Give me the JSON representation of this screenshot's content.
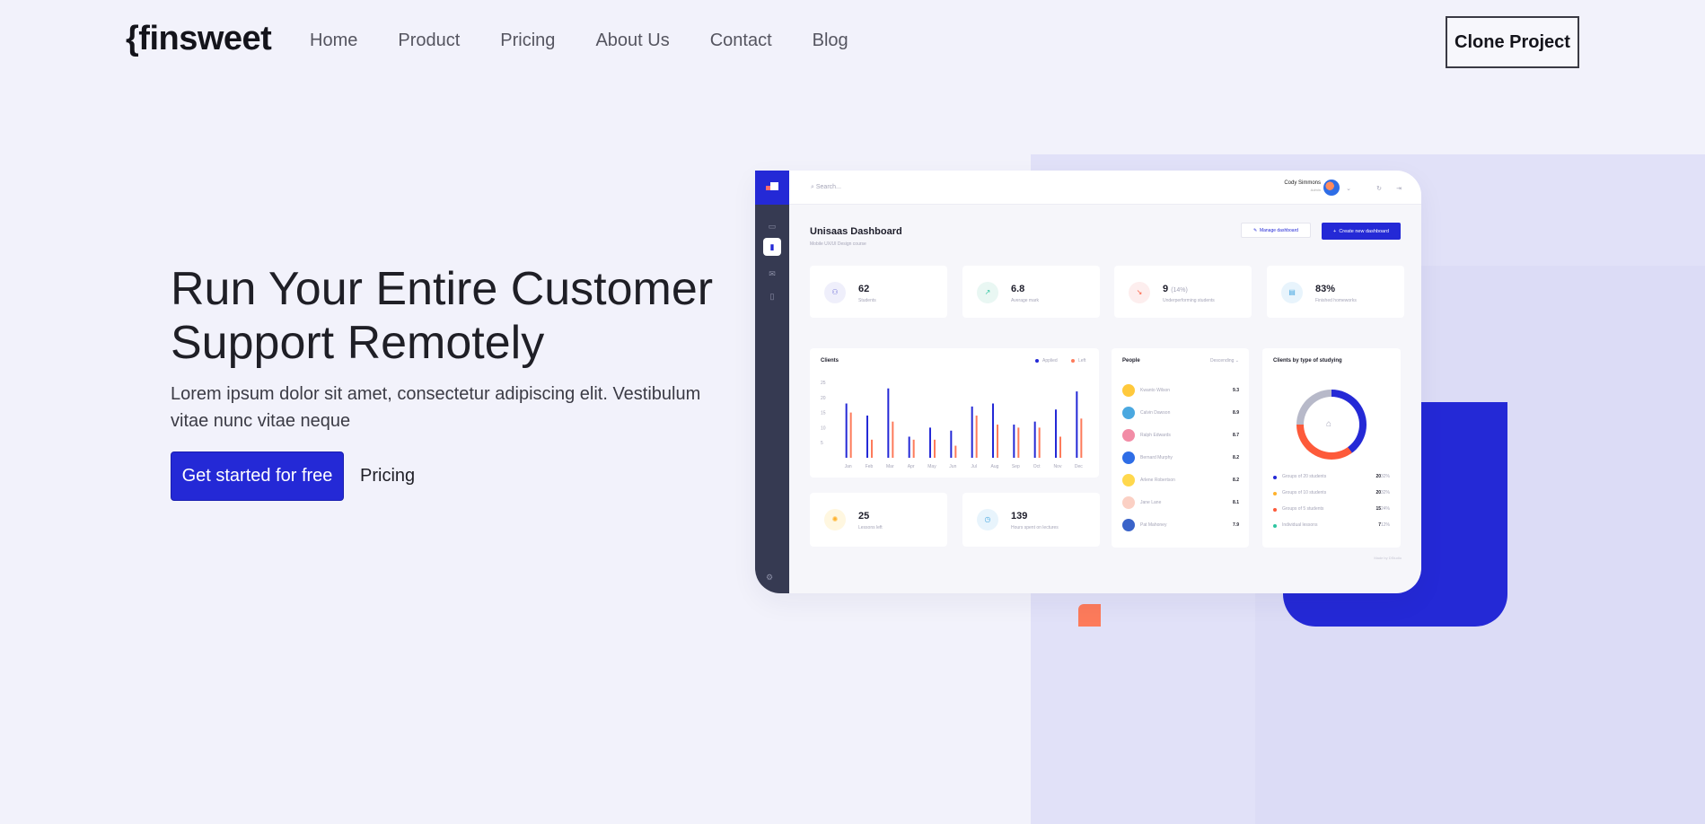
{
  "nav": {
    "logo": "{finsweet",
    "links": [
      "Home",
      "Product",
      "Pricing",
      "About Us",
      "Contact",
      "Blog"
    ],
    "cta": "Clone Project"
  },
  "hero": {
    "title": "Run Your Entire Customer Support Remotely",
    "subtitle": "Lorem ipsum dolor sit amet, consectetur adipiscing elit. Vestibulum vitae nunc vitae neque",
    "primary_button": "Get started for free",
    "secondary_link": "Pricing"
  },
  "colors": {
    "accent": "#2429d6",
    "orange": "#fd7b5b",
    "background": "#f2f2fb"
  },
  "dashboard": {
    "search_placeholder": "Search...",
    "user_name": "Cody Simmons",
    "user_role": "Admin",
    "title": "Unisaas Dashboard",
    "subtitle": "Mobile UX/UI Design course",
    "manage_button": "Manage dashboard",
    "create_button": "Create new dashboard",
    "stats": [
      {
        "value": "62",
        "extra": "",
        "label": "Students",
        "icon": "user-icon"
      },
      {
        "value": "6.8",
        "extra": "",
        "label": "Average mark",
        "icon": "trend-up-icon"
      },
      {
        "value": "9",
        "extra": "(14%)",
        "label": "Underperforming students",
        "icon": "trend-down-icon"
      },
      {
        "value": "83%",
        "extra": "",
        "label": "Finished homeworks",
        "icon": "clipboard-icon"
      }
    ],
    "clients": {
      "title": "Clients",
      "legend_a": "Applied",
      "legend_b": "Left"
    },
    "people": {
      "title": "People",
      "filter": "Descending",
      "list": [
        {
          "name": "Kwanto Wilson",
          "score": "9.3"
        },
        {
          "name": "Calvin Dawson",
          "score": "8.9"
        },
        {
          "name": "Ralph Edwards",
          "score": "8.7"
        },
        {
          "name": "Bernard Murphy",
          "score": "8.2"
        },
        {
          "name": "Arlene Robertson",
          "score": "8.2"
        },
        {
          "name": "Jane Lane",
          "score": "8.1"
        },
        {
          "name": "Pat Mahoney",
          "score": "7.9"
        }
      ]
    },
    "types": {
      "title": "Clients by type of studying",
      "list": [
        {
          "name": "Groups of 20 students",
          "value": "20",
          "pct": "32%",
          "color": "#2429d6"
        },
        {
          "name": "Groups of 10 students",
          "value": "20",
          "pct": "32%",
          "color": "#ffb22c"
        },
        {
          "name": "Groups of 5 students",
          "value": "15",
          "pct": "24%",
          "color": "#fd5a3a"
        },
        {
          "name": "Individual lessons",
          "value": "7",
          "pct": "12%",
          "color": "#2ec5a0"
        }
      ]
    },
    "small_stats": [
      {
        "value": "25",
        "label": "Lessons left",
        "icon": "bulb-icon"
      },
      {
        "value": "139",
        "label": "Hours spent on lectures",
        "icon": "clock-icon"
      }
    ],
    "credit": "Made by DStudio"
  },
  "chart_data": {
    "type": "bar",
    "categories": [
      "Jan",
      "Feb",
      "Mar",
      "Apr",
      "May",
      "Jun",
      "Jul",
      "Aug",
      "Sep",
      "Oct",
      "Nov",
      "Dec"
    ],
    "series": [
      {
        "name": "Applied",
        "values": [
          18,
          14,
          23,
          7,
          10,
          9,
          17,
          18,
          11,
          12,
          16,
          22
        ]
      },
      {
        "name": "Left",
        "values": [
          15,
          6,
          12,
          6,
          6,
          4,
          14,
          11,
          10,
          10,
          7,
          13
        ]
      }
    ],
    "ytick_labels": [
      "25",
      "20",
      "15",
      "10",
      "5"
    ],
    "ylim": [
      0,
      25
    ],
    "grid": false,
    "legend": "top-right"
  }
}
